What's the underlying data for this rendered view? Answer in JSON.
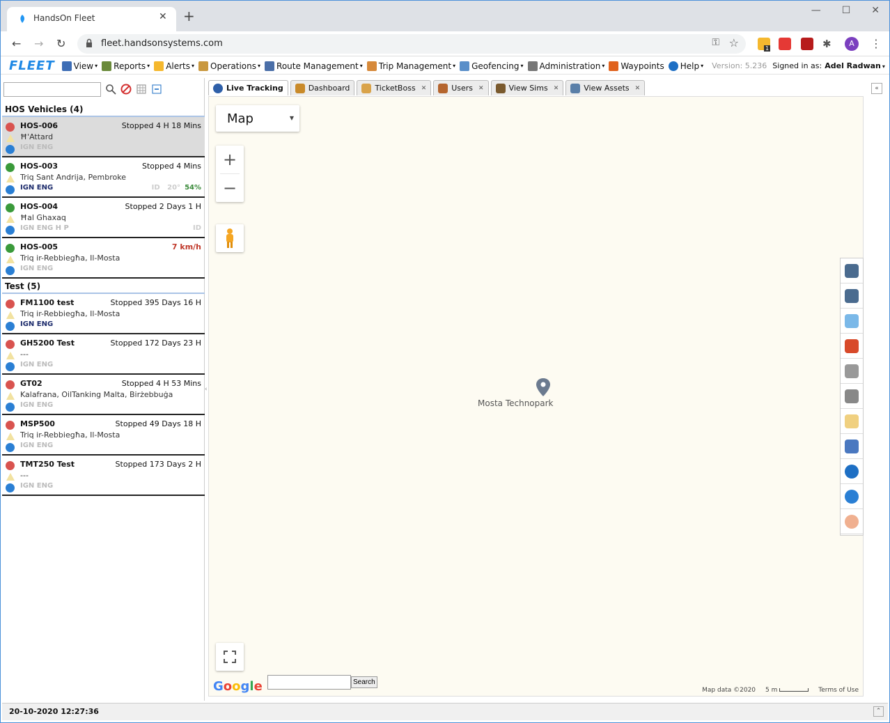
{
  "browser": {
    "tab_title": "HandsOn Fleet",
    "url": "fleet.handsonsystems.com",
    "avatar_letter": "A",
    "extension_badge": "1"
  },
  "app": {
    "logo": "FLEET",
    "menu": [
      {
        "label": "View",
        "icon": "view-icon",
        "has_caret": true
      },
      {
        "label": "Reports",
        "icon": "reports-icon",
        "has_caret": true
      },
      {
        "label": "Alerts",
        "icon": "alert-icon",
        "has_caret": true
      },
      {
        "label": "Operations",
        "icon": "operations-icon",
        "has_caret": true
      },
      {
        "label": "Route Management",
        "icon": "route-icon",
        "has_caret": true
      },
      {
        "label": "Trip Management",
        "icon": "trip-icon",
        "has_caret": true
      },
      {
        "label": "Geofencing",
        "icon": "geofence-icon",
        "has_caret": true
      },
      {
        "label": "Administration",
        "icon": "admin-icon",
        "has_caret": true
      },
      {
        "label": "Waypoints",
        "icon": "flag-icon",
        "has_caret": false
      },
      {
        "label": "Help",
        "icon": "help-icon",
        "has_caret": true
      }
    ],
    "version": "Version: 5.236",
    "signed_in_label": "Signed in as:",
    "signed_in_user": "Adel Radwan"
  },
  "tabs": [
    {
      "label": "Live Tracking",
      "active": true,
      "closable": false
    },
    {
      "label": "Dashboard",
      "active": false,
      "closable": false
    },
    {
      "label": "TicketBoss",
      "active": false,
      "closable": true
    },
    {
      "label": "Users",
      "active": false,
      "closable": true
    },
    {
      "label": "View Sims",
      "active": false,
      "closable": true
    },
    {
      "label": "View Assets",
      "active": false,
      "closable": true
    }
  ],
  "groups": [
    {
      "title": "HOS Vehicles (4)",
      "vehicles": [
        {
          "name": "HOS-006",
          "status": "Stopped 4 H 18 Mins",
          "status_red": false,
          "address": "Ħ'Attard",
          "ign": "IGN ENG",
          "ign_on": false,
          "extra": "",
          "pct": "",
          "state": "error",
          "selected": true
        },
        {
          "name": "HOS-003",
          "status": "Stopped 4 Mins",
          "status_red": false,
          "address": "Triq Sant Andrija, Pembroke",
          "ign": "IGN ENG",
          "ign_on": true,
          "extra": "ID   20°",
          "pct": "54%",
          "state": "ok",
          "selected": false
        },
        {
          "name": "HOS-004",
          "status": "Stopped 2 Days 1 H",
          "status_red": false,
          "address": "Ħal Ghaxaq",
          "ign": "IGN ENG H  P",
          "ign_on": false,
          "extra": "ID",
          "pct": "",
          "state": "ok",
          "selected": false
        },
        {
          "name": "HOS-005",
          "status": "7 km/h",
          "status_red": true,
          "address": "Triq ir-Rebbiegħa, Il-Mosta",
          "ign": "IGN ENG",
          "ign_on": false,
          "extra": "",
          "pct": "",
          "state": "ok",
          "selected": false
        }
      ]
    },
    {
      "title": "Test (5)",
      "vehicles": [
        {
          "name": "FM1100 test",
          "status": "Stopped 395 Days 16 H",
          "status_red": false,
          "address": "Triq ir-Rebbiegħa, Il-Mosta",
          "ign": "IGN ENG",
          "ign_on": true,
          "extra": "",
          "pct": "",
          "state": "error",
          "selected": false
        },
        {
          "name": "GH5200 Test",
          "status": "Stopped 172 Days 23 H",
          "status_red": false,
          "address": "---",
          "ign": "IGN ENG",
          "ign_on": false,
          "extra": "",
          "pct": "",
          "state": "error",
          "selected": false
        },
        {
          "name": "GT02",
          "status": "Stopped 4 H 53 Mins",
          "status_red": false,
          "address": "Kalafrana, OilTanking Malta, Birżebbuġa",
          "ign": "IGN ENG",
          "ign_on": false,
          "extra": "",
          "pct": "",
          "state": "error",
          "selected": false
        },
        {
          "name": "MSP500",
          "status": "Stopped 49 Days 18 H",
          "status_red": false,
          "address": "Triq ir-Rebbiegħa, Il-Mosta",
          "ign": "IGN ENG",
          "ign_on": false,
          "extra": "",
          "pct": "",
          "state": "error",
          "selected": false
        },
        {
          "name": "TMT250 Test",
          "status": "Stopped 173 Days 2 H",
          "status_red": false,
          "address": "---",
          "ign": "IGN ENG",
          "ign_on": false,
          "extra": "",
          "pct": "",
          "state": "error",
          "selected": false
        }
      ]
    }
  ],
  "map": {
    "type_label": "Map",
    "zoom_in": "+",
    "zoom_out": "−",
    "place_label": "Mosta Technopark",
    "google_logo": "Google",
    "search_button": "Search",
    "attribution": "Map data ©2020",
    "scale": "5 m",
    "terms": "Terms of Use",
    "right_tools": [
      "home-icon",
      "add-home-icon",
      "hand-icon",
      "add-flag-icon",
      "traffic-light-icon",
      "speaker-icon",
      "weather-icon",
      "car-icon",
      "layers-icon",
      "stack-icon",
      "cluster-icon"
    ]
  },
  "status_bar": {
    "datetime": "20-10-2020 12:27:36"
  },
  "colors": {
    "brand": "#1e88e5",
    "ok": "#3a9a3a",
    "error": "#d9534f",
    "selected_row": "#dcdcdc"
  }
}
